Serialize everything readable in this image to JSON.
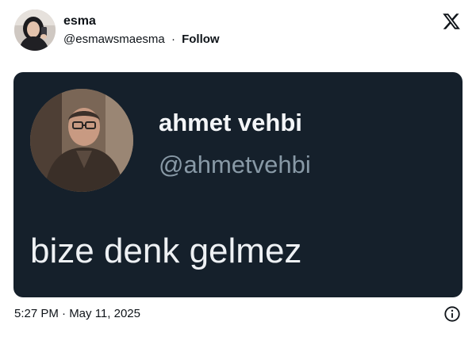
{
  "tweet": {
    "author": {
      "name": "esma",
      "handle": "@esmawsmaesma",
      "separator": "·",
      "follow_label": "Follow"
    },
    "logo_icon": "x-logo-icon",
    "media": {
      "quoted_name": "ahmet vehbi",
      "quoted_handle": "@ahmetvehbi",
      "quoted_text": "bize denk gelmez",
      "background_color": "#15202b"
    },
    "timestamp": "5:27 PM · May 11, 2025",
    "info_icon": "info-icon"
  }
}
